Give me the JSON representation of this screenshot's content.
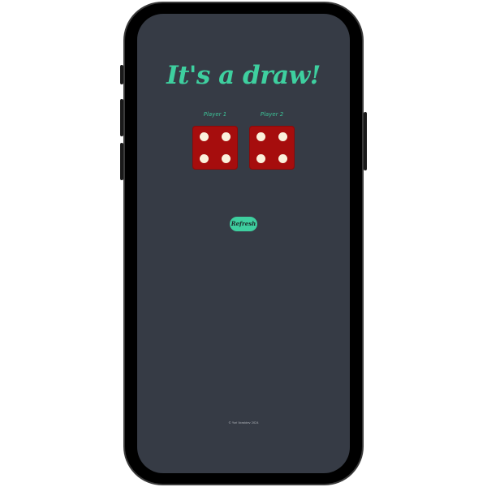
{
  "game": {
    "title": "It's a draw!",
    "refresh_label": "Refresh",
    "footer": "© Yuri Vorobiev 2024"
  },
  "players": [
    {
      "label": "Player 1",
      "die_value": 4
    },
    {
      "label": "Player 2",
      "die_value": 4
    }
  ],
  "colors": {
    "screen_background": "#363b45",
    "accent": "#3ecf9f",
    "die_face": "#a60d0d",
    "pip": "#fbf1dc"
  }
}
